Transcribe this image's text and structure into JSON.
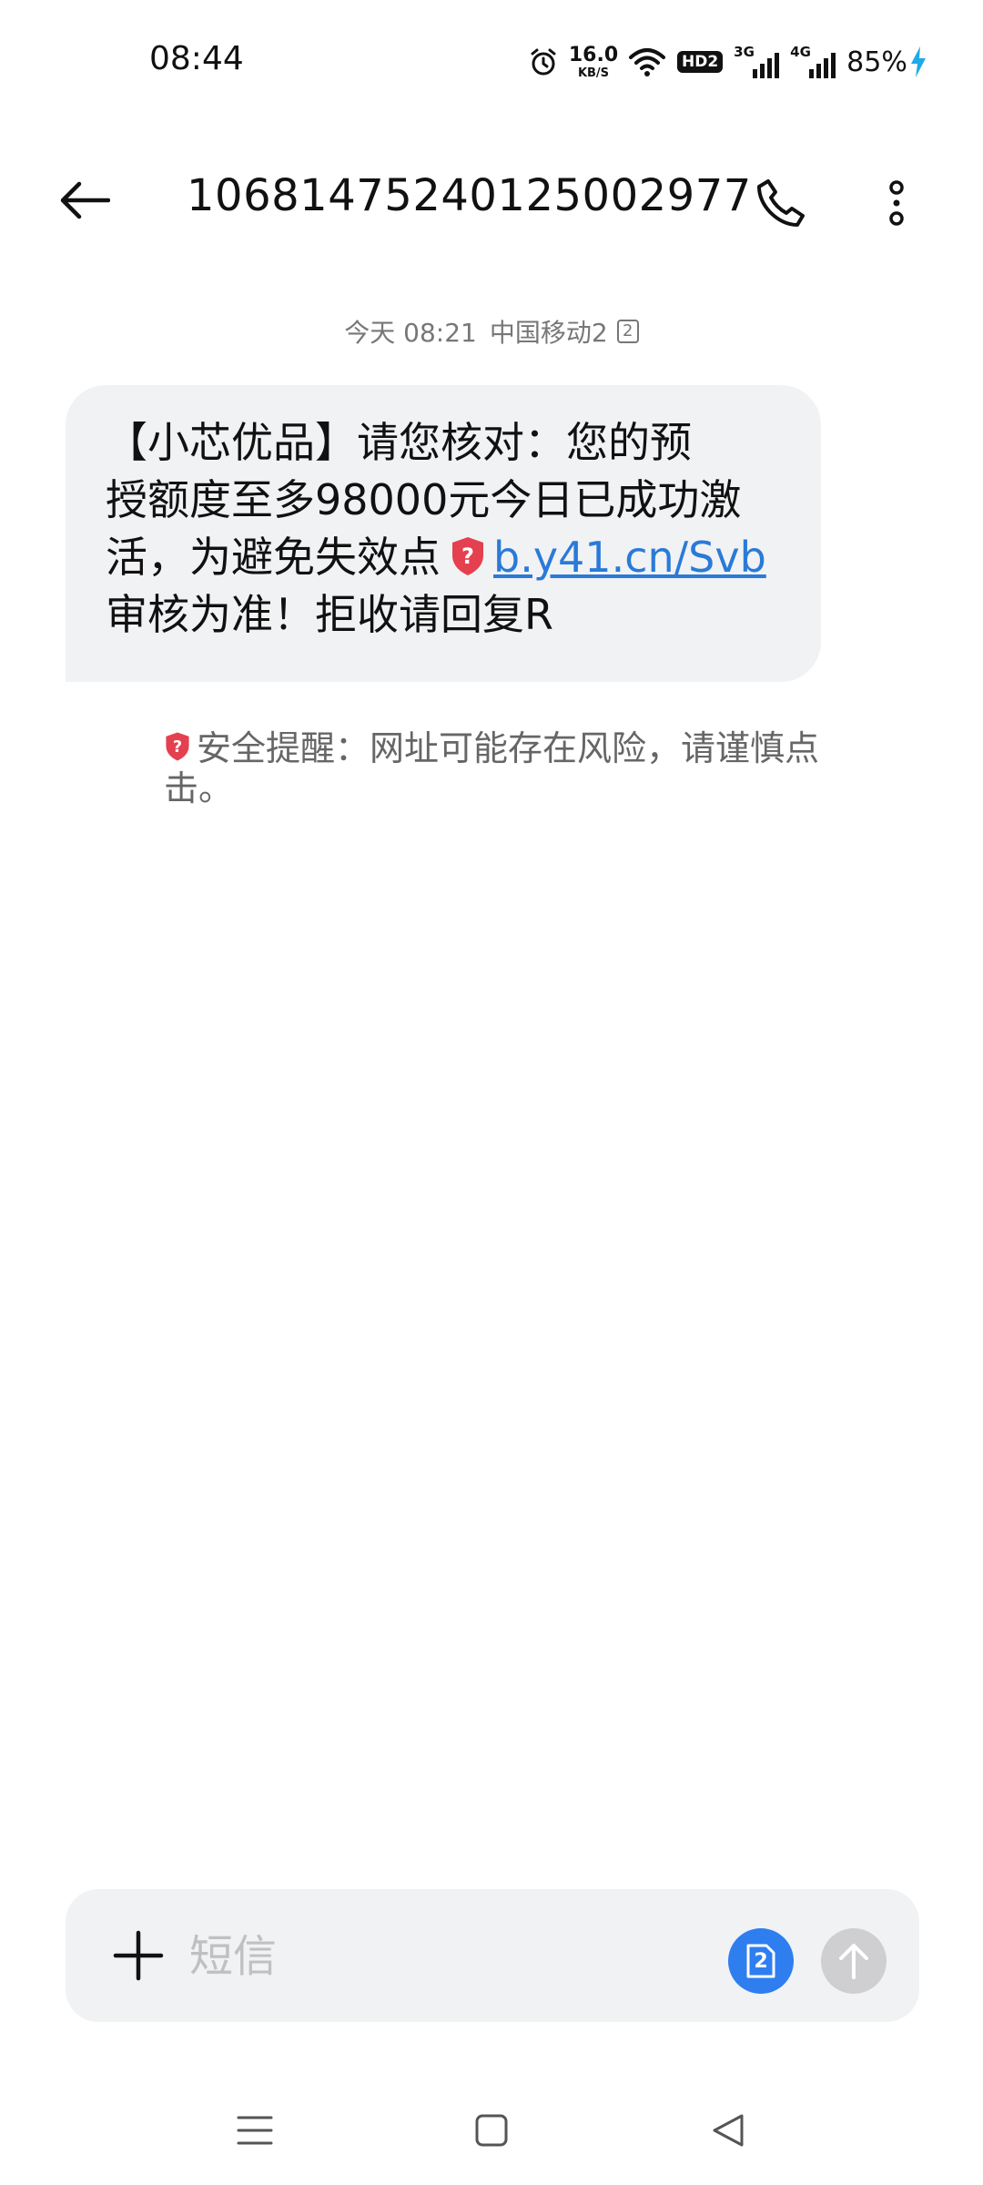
{
  "status_bar": {
    "time": "08:44",
    "net_speed_value": "16.0",
    "net_speed_unit": "KB/S",
    "hd_badge": "HD2",
    "signal_1_label": "3G",
    "signal_2_label": "4G",
    "battery": "85%"
  },
  "header": {
    "contact": "10681475240125002977",
    "back_icon": "arrow-left-icon",
    "call_icon": "phone-icon",
    "more_icon": "more-vertical-icon"
  },
  "message": {
    "meta_time": "今天 08:21",
    "meta_carrier": "中国移动2",
    "meta_sim": "2",
    "line1": "【小芯优品】请您核对：您的预",
    "line2": "授额度至多98000元今日已成功激",
    "line3_text": "活，为避免失效点",
    "link": "b.y41.cn/Svb",
    "line4": "审核为准！拒收请回复R"
  },
  "warning": {
    "text": "安全提醒：网址可能存在风险，请谨慎点击。"
  },
  "compose": {
    "placeholder": "短信",
    "sim_label": "2"
  },
  "colors": {
    "accent": "#2e7ef0",
    "link": "#2a7ad8",
    "shield_red": "#e5404f",
    "bubble_bg": "#f1f2f4"
  }
}
